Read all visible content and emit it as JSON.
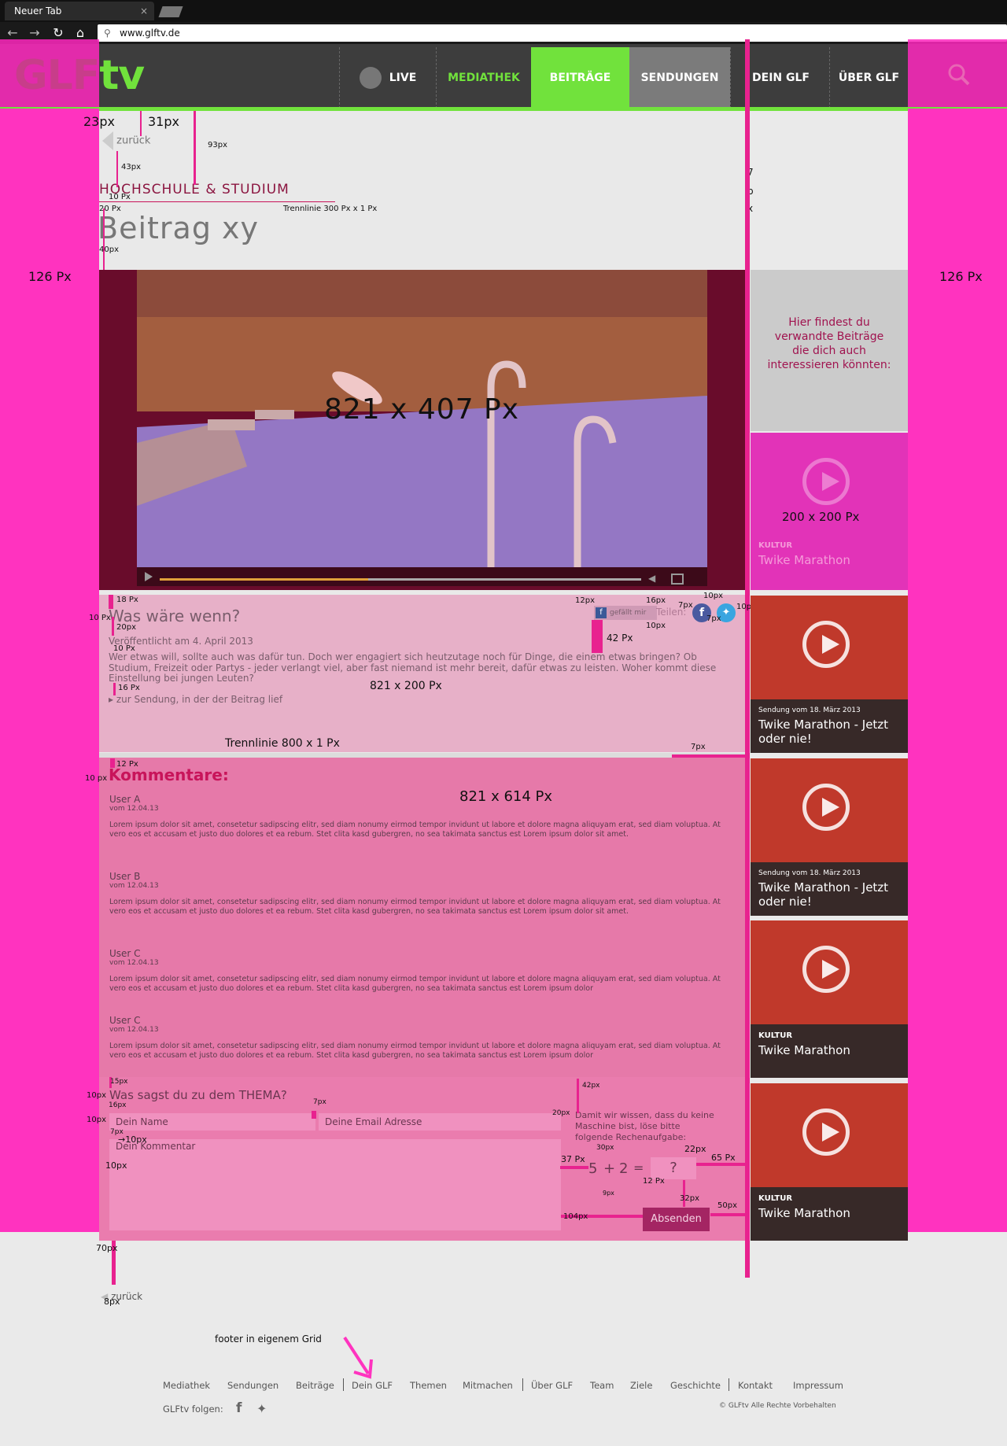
{
  "browser": {
    "tab_title": "Neuer Tab",
    "tab_close": "×",
    "url": "www.glftv.de"
  },
  "site": {
    "logo_glf": "GLF",
    "logo_tv": "tv",
    "nav": [
      {
        "label": "LIVE",
        "active": false
      },
      {
        "label": "MEDIATHEK",
        "active": false
      },
      {
        "label": "BEITRÄGE",
        "active": true
      },
      {
        "label": "SENDUNGEN",
        "active": false
      },
      {
        "label": "DEIN GLF",
        "active": false
      },
      {
        "label": "ÜBER GLF",
        "active": false
      }
    ],
    "colors": {
      "accent_green": "#71e23c",
      "brand_magenta": "#c8145a",
      "annotation_pink": "#ff33bf"
    }
  },
  "page": {
    "back_label": "zurück",
    "category": "HOCHSCHULE & STUDIUM",
    "title": "Beitrag xy",
    "back_label_bottom": "zurück"
  },
  "video": {
    "size_label": "821 x 407 Px"
  },
  "article": {
    "heading": "Was wäre wenn?",
    "published": "Veröffentlicht am 4. April 2013",
    "body": "Wer etwas will, sollte auch was dafür tun. Doch wer engagiert sich heutzutage noch für Dinge, die einem etwas bringen? Ob Studium, Freizeit oder Partys - jeder verlangt viel, aber fast niemand ist mehr bereit, dafür etwas zu leisten. Woher kommt diese Einstellung bei jungen Leuten?",
    "link": "zur Sendung, in der der Beitrag lief",
    "like_label": "gefällt mir",
    "share_label": "Teilen:",
    "size_label": "821 x 200 Px"
  },
  "comments": {
    "heading": "Kommentare:",
    "size_label": "821 x 614 Px",
    "items": [
      {
        "user": "User A",
        "date": "vom 12.04.13",
        "text": "Lorem ipsum dolor sit amet, consetetur sadipscing elitr, sed diam nonumy eirmod tempor invidunt ut labore et dolore magna aliquyam erat, sed diam voluptua. At vero eos et accusam et justo duo dolores et ea rebum. Stet clita kasd gubergren, no sea takimata sanctus est Lorem ipsum dolor sit amet."
      },
      {
        "user": "User B",
        "date": "vom 12.04.13",
        "text": "Lorem ipsum dolor sit amet, consetetur sadipscing elitr, sed diam nonumy eirmod tempor invidunt ut labore et dolore magna aliquyam erat, sed diam voluptua. At vero eos et accusam et justo duo dolores et ea rebum. Stet clita kasd gubergren, no sea takimata sanctus est Lorem ipsum dolor sit amet."
      },
      {
        "user": "User C",
        "date": "vom 12.04.13",
        "text": "Lorem ipsum dolor sit amet, consetetur sadipscing elitr, sed diam nonumy eirmod tempor invidunt ut labore et dolore magna aliquyam erat, sed diam voluptua. At vero eos et accusam et justo duo dolores et ea rebum. Stet clita kasd gubergren, no sea takimata sanctus est Lorem ipsum dolor"
      },
      {
        "user": "User C",
        "date": "vom 12.04.13",
        "text": "Lorem ipsum dolor sit amet, consetetur sadipscing elitr, sed diam nonumy eirmod tempor invidunt ut labore et dolore magna aliquyam erat, sed diam voluptua. At vero eos et accusam et justo duo dolores et ea rebum. Stet clita kasd gubergren, no sea takimata sanctus est Lorem ipsum dolor"
      }
    ]
  },
  "form": {
    "heading": "Was sagst du zu dem THEMA?",
    "name_placeholder": "Dein Name",
    "email_placeholder": "Deine Email Adresse",
    "comment_placeholder": "Dein Kommentar",
    "captcha_text": "Damit wir wissen, dass du keine Maschine bist, löse bitte folgende Rechenaufgabe:",
    "captcha_a": "5",
    "captcha_op": "+",
    "captcha_b": "2",
    "captcha_eq": "=",
    "captcha_answer": "?",
    "submit": "Absenden"
  },
  "sidebar": {
    "intro": "Hier findest du verwandte Beiträge die dich auch interessieren könnten:",
    "size_label": "200 x 200 Px",
    "cards": [
      {
        "category": "KULTUR",
        "date": "",
        "title": "Twike Marathon"
      },
      {
        "category": "",
        "date": "Sendung vom 18. März 2013",
        "title": "Twike Marathon - Jetzt oder nie!"
      },
      {
        "category": "",
        "date": "Sendung vom 18. März 2013",
        "title": "Twike Marathon - Jetzt oder nie!"
      },
      {
        "category": "KULTUR",
        "date": "",
        "title": "Twike Marathon"
      },
      {
        "category": "KULTUR",
        "date": "",
        "title": "Twike Marathon"
      }
    ]
  },
  "annotations": {
    "side_left": "126 Px",
    "side_right": "126 Px",
    "a23": "23px",
    "a31": "31px",
    "a93": "93px",
    "a43": "43px",
    "a10px": "10 Px",
    "a20px": "20 Px",
    "trenn300": "Trennlinie 300 Px x 1 Px",
    "a40px": "40px",
    "a7": "7",
    "ap": "p",
    "ax": "x",
    "a18": "18 Px",
    "a10b": "10 Px",
    "a20b": "20px",
    "a10c": "10 Px",
    "a16": "16 Px",
    "a12": "12px",
    "a16b": "16px",
    "a7b": "7px",
    "a10d": "10px",
    "a7c": "7px",
    "a10e": "10px",
    "a10f": "10px",
    "a42": "42 Px",
    "trenn800": "Trennlinie 800 x 1 Px",
    "a7d": "7px",
    "a12b": "12 Px",
    "a10g": "10 px",
    "a15": "15px",
    "a10h": "10px",
    "a16c": "16px",
    "a7e": "7px",
    "a10i": "10px",
    "a7f": "7px",
    "a10j": "→10px",
    "a10k": "10px",
    "a42b": "42px",
    "a20c": "20px",
    "a30": "30px",
    "a22": "22px",
    "a37": "37 Px",
    "a65": "65 Px",
    "a12c": "12 Px",
    "a9": "9px",
    "a32": "32px",
    "a50": "50px",
    "a104": "104px",
    "a70": "70px",
    "a8": "8px",
    "footer_note": "footer in eigenem Grid"
  },
  "footer": {
    "links": [
      "Mediathek",
      "Sendungen",
      "Beiträge",
      "Dein GLF",
      "Themen",
      "Mitmachen",
      "Über GLF",
      "Team",
      "Ziele",
      "Geschichte",
      "Kontakt",
      "Impressum"
    ],
    "follow_label": "GLFtv folgen:",
    "copyright": "© GLFtv Alle Rechte Vorbehalten"
  }
}
